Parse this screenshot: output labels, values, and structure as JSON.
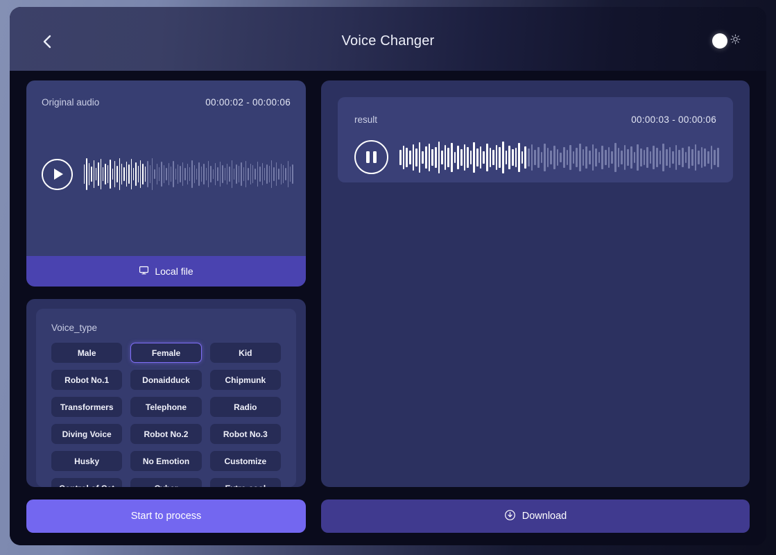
{
  "header": {
    "title": "Voice Changer",
    "back_icon": "chevron-left-icon",
    "theme_toggle": {
      "state": "light",
      "sun_icon": "sun-icon"
    }
  },
  "original_audio": {
    "label": "Original audio",
    "time_range": "00:00:02 - 00:00:06",
    "transport_state": "paused",
    "play_icon": "play-icon",
    "progress_percent": 30,
    "local_file": {
      "label": "Local file",
      "icon": "monitor-icon"
    },
    "waveform": [
      28,
      46,
      32,
      22,
      40,
      18,
      34,
      44,
      20,
      30,
      26,
      42,
      16,
      38,
      24,
      46,
      30,
      20,
      36,
      28,
      44,
      18,
      34,
      24,
      40,
      30,
      22,
      38,
      26,
      46,
      14,
      30,
      20,
      36,
      26,
      18,
      32,
      22,
      38,
      16,
      28,
      24,
      34,
      18,
      30,
      20,
      40,
      26,
      16,
      34,
      22,
      30,
      18,
      38,
      24,
      14,
      32,
      20,
      36,
      26,
      18,
      30,
      22,
      40,
      16,
      28,
      24,
      34,
      20,
      38,
      18,
      30,
      26,
      16,
      36,
      22,
      32,
      18,
      28,
      24,
      40,
      20,
      34,
      16,
      30,
      26,
      18,
      38,
      22,
      28
    ]
  },
  "result_audio": {
    "label": "result",
    "time_range": "00:00:03 - 00:00:06",
    "transport_state": "playing",
    "pause_icon": "pause-icon",
    "progress_percent": 40,
    "waveform": [
      22,
      34,
      28,
      20,
      38,
      26,
      44,
      18,
      32,
      40,
      24,
      30,
      46,
      20,
      36,
      28,
      42,
      16,
      34,
      24,
      38,
      30,
      20,
      44,
      26,
      32,
      18,
      40,
      28,
      22,
      36,
      30,
      46,
      20,
      34,
      24,
      28,
      42,
      18,
      32,
      26,
      38,
      22,
      30,
      16,
      40,
      28,
      20,
      34,
      24,
      14,
      30,
      22,
      36,
      18,
      28,
      40,
      24,
      32,
      20,
      38,
      26,
      16,
      34,
      22,
      30,
      18,
      42,
      28,
      20,
      36,
      24,
      32,
      16,
      38,
      26,
      22,
      30,
      18,
      34,
      28,
      20,
      40,
      24,
      30,
      18,
      36,
      22,
      28,
      16,
      32,
      24,
      38,
      20,
      30,
      26,
      18,
      34,
      22,
      28
    ]
  },
  "voice_type": {
    "label": "Voice_type",
    "selected": "Female",
    "options": [
      "Male",
      "Female",
      "Kid",
      "Robot No.1",
      "Donaidduck",
      "Chipmunk",
      "Transformers",
      "Telephone",
      "Radio",
      "Diving Voice",
      "Robot No.2",
      "Robot No.3",
      "Husky",
      "No Emotion",
      "Customize",
      "Control of Cat",
      "Cyber",
      "Extra-cool"
    ]
  },
  "footer": {
    "start_process_label": "Start to process",
    "download_label": "Download",
    "download_icon": "download-circle-icon"
  },
  "colors": {
    "accent_purple": "#7367f0",
    "selected_border": "#7f6ef6",
    "local_file_bg": "#4a43b0",
    "download_bg": "#403a8f",
    "card_bg": "#2c3160",
    "audio_card_bg": "#373e72",
    "window_bg": "#0a0b1c"
  }
}
